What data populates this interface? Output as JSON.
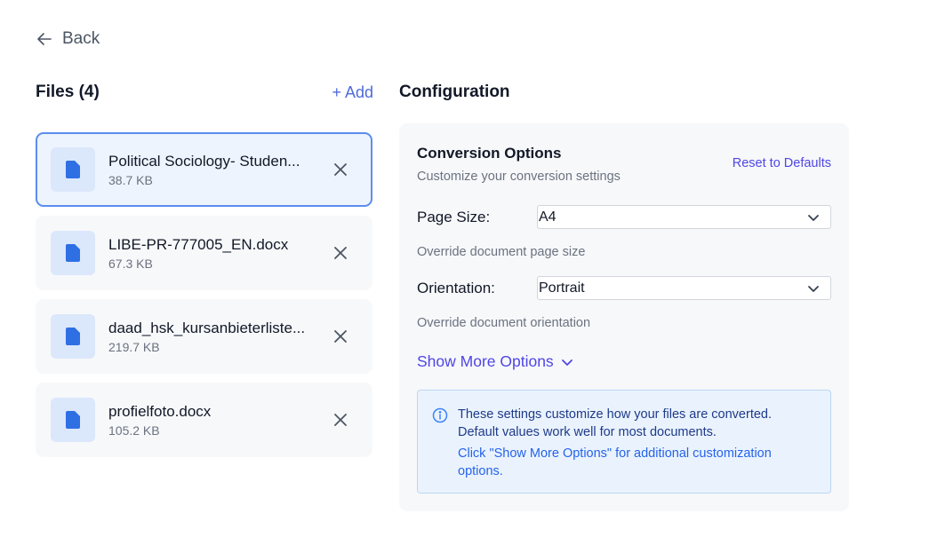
{
  "nav": {
    "back_label": "Back"
  },
  "files": {
    "title": "Files (4)",
    "add_label": "+ Add",
    "items": [
      {
        "name": "Political Sociology- Studen...",
        "size": "38.7 KB",
        "selected": true
      },
      {
        "name": "LIBE-PR-777005_EN.docx",
        "size": "67.3 KB",
        "selected": false
      },
      {
        "name": "daad_hsk_kursanbieterliste...",
        "size": "219.7 KB",
        "selected": false
      },
      {
        "name": "profielfoto.docx",
        "size": "105.2 KB",
        "selected": false
      }
    ]
  },
  "config": {
    "title": "Configuration",
    "options_title": "Conversion Options",
    "options_subtitle": "Customize your conversion settings",
    "reset_label": "Reset to Defaults",
    "page_size": {
      "label": "Page Size:",
      "value": "A4",
      "help": "Override document page size"
    },
    "orientation": {
      "label": "Orientation:",
      "value": "Portrait",
      "help": "Override document orientation"
    },
    "show_more_label": "Show More Options",
    "info": {
      "line1": "These settings customize how your files are converted. Default values work well for most documents.",
      "hint": "Click \"Show More Options\" for additional customization options."
    }
  },
  "colors": {
    "accent": "#4f46e5",
    "link_blue": "#4f6bd8",
    "selected_border": "#5b8def",
    "file_icon": "#2f6fe4"
  },
  "icons": [
    "arrow-left-icon",
    "file-icon",
    "close-icon",
    "chevron-down-icon",
    "info-icon"
  ]
}
